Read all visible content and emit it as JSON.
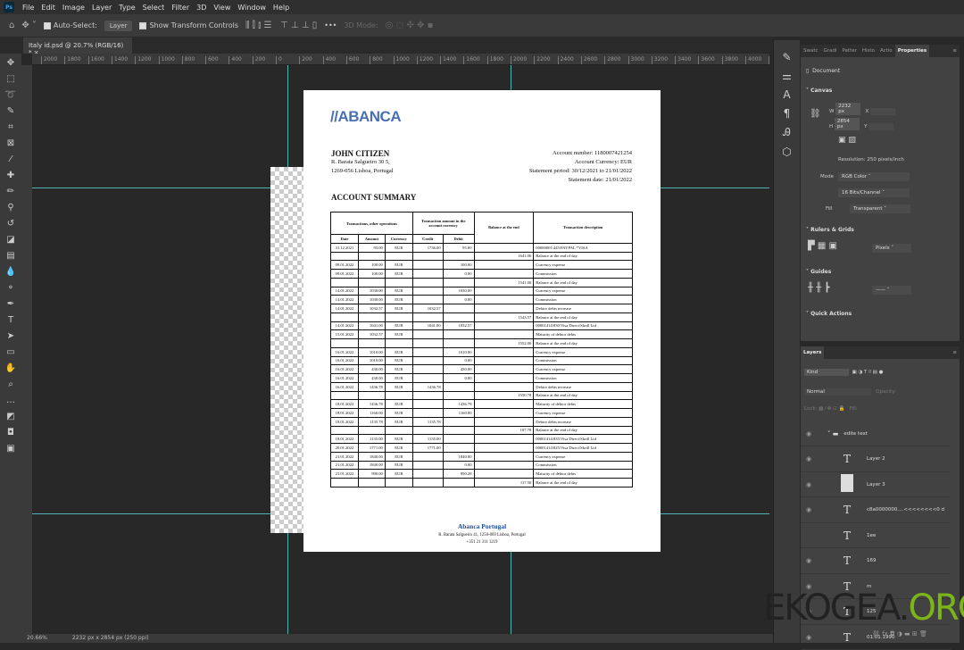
{
  "app": {
    "menu": [
      "File",
      "Edit",
      "Image",
      "Layer",
      "Type",
      "Select",
      "Filter",
      "3D",
      "View",
      "Window",
      "Help"
    ]
  },
  "options": {
    "auto_select": "Auto-Select:",
    "layer_select": "Layer",
    "show_transform": "Show Transform Controls",
    "more": "•••",
    "mode_3d": "3D Mode:"
  },
  "tab": {
    "title": "Italy id.psd @ 20.7% (RGB/16) *",
    "close": "×"
  },
  "ruler": {
    "labels": [
      "2000",
      "1800",
      "1600",
      "1400",
      "1200",
      "1000",
      "800",
      "600",
      "400",
      "200",
      "0",
      "200",
      "400",
      "600",
      "800",
      "1000",
      "1200",
      "1400",
      "1600",
      "1800",
      "2000",
      "2200",
      "2400",
      "2600",
      "2800",
      "3000",
      "3200",
      "3400",
      "3600",
      "3800",
      "4000",
      "4200"
    ]
  },
  "status": {
    "zoom": "20.66%",
    "doc": "2232 px x 2854 px (250 ppi)"
  },
  "document": {
    "logo": "//ABANCA",
    "name": "JOHN CITIZEN",
    "address1": "R. Barata Salgueiro 30 5,",
    "address2": "1269-056 Lisboa, Portugal",
    "account_number": "Account number: 1180007421254",
    "currency": "Account Currency: EUR",
    "period": "Statement period: 30/12/2021 to 21/01/2022",
    "date": "Statement date: 21/01/2022",
    "summary_title": "ACCOUNT SUMMARY",
    "headers": {
      "group1": "Transactions, other operations",
      "group2": "Transaction amount in the account currency",
      "balance": "Balance at the end",
      "description": "Transaction description",
      "date": "Date",
      "amount": "Amount",
      "currency": "Currency",
      "credit": "Credit",
      "debit": "Debit"
    },
    "rows": [
      [
        "31.12.2021",
        "95.00",
        "EUR",
        "1736.00",
        "95.00",
        "",
        "00000001\\445\\PAYPAL *VISA"
      ],
      [
        "",
        "",
        "",
        "",
        "",
        "1641.00",
        "Balance at the end of day"
      ],
      [
        "09.01.2022",
        "100.00",
        "EUR",
        "",
        "100.00",
        "",
        "Currency expense"
      ],
      [
        "09.01.2022",
        "100.00",
        "EUR",
        "",
        "0.00",
        "",
        "Commission"
      ],
      [
        "",
        "",
        "",
        "",
        "",
        "1541.00",
        "Balance at the end of day"
      ],
      [
        "14.01.2022",
        "1030.00",
        "EUR",
        "",
        "1030.00",
        "",
        "Currency expense"
      ],
      [
        "14.01.2022",
        "1030.00",
        "EUR",
        "",
        "0.00",
        "",
        "Commission"
      ],
      [
        "14.01.2022",
        "1032.57",
        "EUR",
        "1032.57",
        "",
        "",
        "Debtor debts increase"
      ],
      [
        "",
        "",
        "",
        "",
        "",
        "1543.57",
        "Balance at the end of day"
      ],
      [
        "14.01.2022",
        "1041.00",
        "EUR",
        "1041.00",
        "1032.57",
        "",
        "00001414\\830\\Visa Direct\\Skrill Ltd"
      ],
      [
        "15.01.2022",
        "1032.57",
        "EUR",
        "",
        "",
        "",
        "Maturity of debtor debts"
      ],
      [
        "",
        "",
        "",
        "",
        "",
        "1552.00",
        "Balance at the end of day"
      ],
      [
        "16.01.2022",
        "1010.00",
        "EUR",
        "",
        "1010.00",
        "",
        "Currency expense"
      ],
      [
        "16.01.2022",
        "1010.00",
        "EUR",
        "",
        "0.00",
        "",
        "Commission"
      ],
      [
        "16.01.2022",
        "430.00",
        "EUR",
        "",
        "430.00",
        "",
        "Currency expense"
      ],
      [
        "16.01.2022",
        "430.00",
        "EUR",
        "",
        "0.00",
        "",
        "Commission"
      ],
      [
        "16.01.2022",
        "1436.78",
        "EUR",
        "1436.78",
        "",
        "",
        "Debtor debts increase"
      ],
      [
        "",
        "",
        "",
        "",
        "",
        "1550.78",
        "Balance at the end of day"
      ],
      [
        "18.01.2022",
        "1436.78",
        "EUR",
        "",
        "1436.78",
        "",
        "Maturity of debtor debts"
      ],
      [
        "18.01.2022",
        "1160.00",
        "EUR",
        "",
        "1160.00",
        "",
        "Currency expense"
      ],
      [
        "18.01.2022",
        "1135.78",
        "EUR",
        "1135.78",
        "",
        "",
        "Debtor debts increase"
      ],
      [
        "",
        "",
        "",
        "",
        "",
        "107.78",
        "Balance at the end of day"
      ],
      [
        "18.01.2022",
        "1135.00",
        "EUR",
        "1135.00",
        "",
        "",
        "00001414\\835\\Visa Direct\\Skrill Ltd"
      ],
      [
        "20.01.2022",
        "1771.00",
        "EUR",
        "1771.00",
        "",
        "",
        "00001414\\825\\Visa Direct\\Skrill Ltd"
      ],
      [
        "21.01.2022",
        "1840.00",
        "EUR",
        "",
        "1840.00",
        "",
        "Currency expense"
      ],
      [
        "21.01.2022",
        "1840.00",
        "EUR",
        "",
        "0.00",
        "",
        "Commission"
      ],
      [
        "21.01.2022",
        "990.00",
        "EUR",
        "",
        "990.28",
        "",
        "Maturity of debtor debts"
      ],
      [
        "",
        "",
        "",
        "",
        "",
        "117.50",
        "Balance at the end of day"
      ]
    ],
    "footer_title": "Abanca Portugal",
    "footer_address": "R. Barata Salgueiro 41, 1250-069 Lisboa, Portugal",
    "footer_phone": "+351 21 311 1219"
  },
  "properties": {
    "tabs": [
      "Swatc",
      "Gradi",
      "Patter",
      "Histo",
      "Actio",
      "Properties"
    ],
    "doc_label": "Document",
    "canvas": "Canvas",
    "w_label": "W",
    "w": "2232 px",
    "h_label": "H",
    "h": "2854 px",
    "x_label": "X",
    "y_label": "Y",
    "resolution": "Resolution: 250 pixels/inch",
    "mode_label": "Mode",
    "mode": "RGB Color",
    "depth": "16 Bits/Channel",
    "fill_label": "Fill",
    "fill": "Transparent",
    "rulers": "Rulers & Grids",
    "units": "Pixels",
    "guides": "Guides",
    "quick": "Quick Actions"
  },
  "layers": {
    "title": "Layers",
    "kind": "Kind",
    "blend": "Normal",
    "opacity": "Opacity:",
    "lock": "Lock:",
    "fill": "Fill:",
    "items": [
      "edite text",
      "Layer 2",
      "Layer 3",
      "c8a0000000....<<<<<<<<0 d",
      "1ee",
      "169",
      "m",
      "125",
      "01.01.1990"
    ]
  },
  "watermark": {
    "a": "EKOGEA.",
    "b": "ORG"
  },
  "colors": {
    "guide": "#4fb3b3",
    "brand": "#4a6fb5",
    "footer": "#1f4b93"
  }
}
